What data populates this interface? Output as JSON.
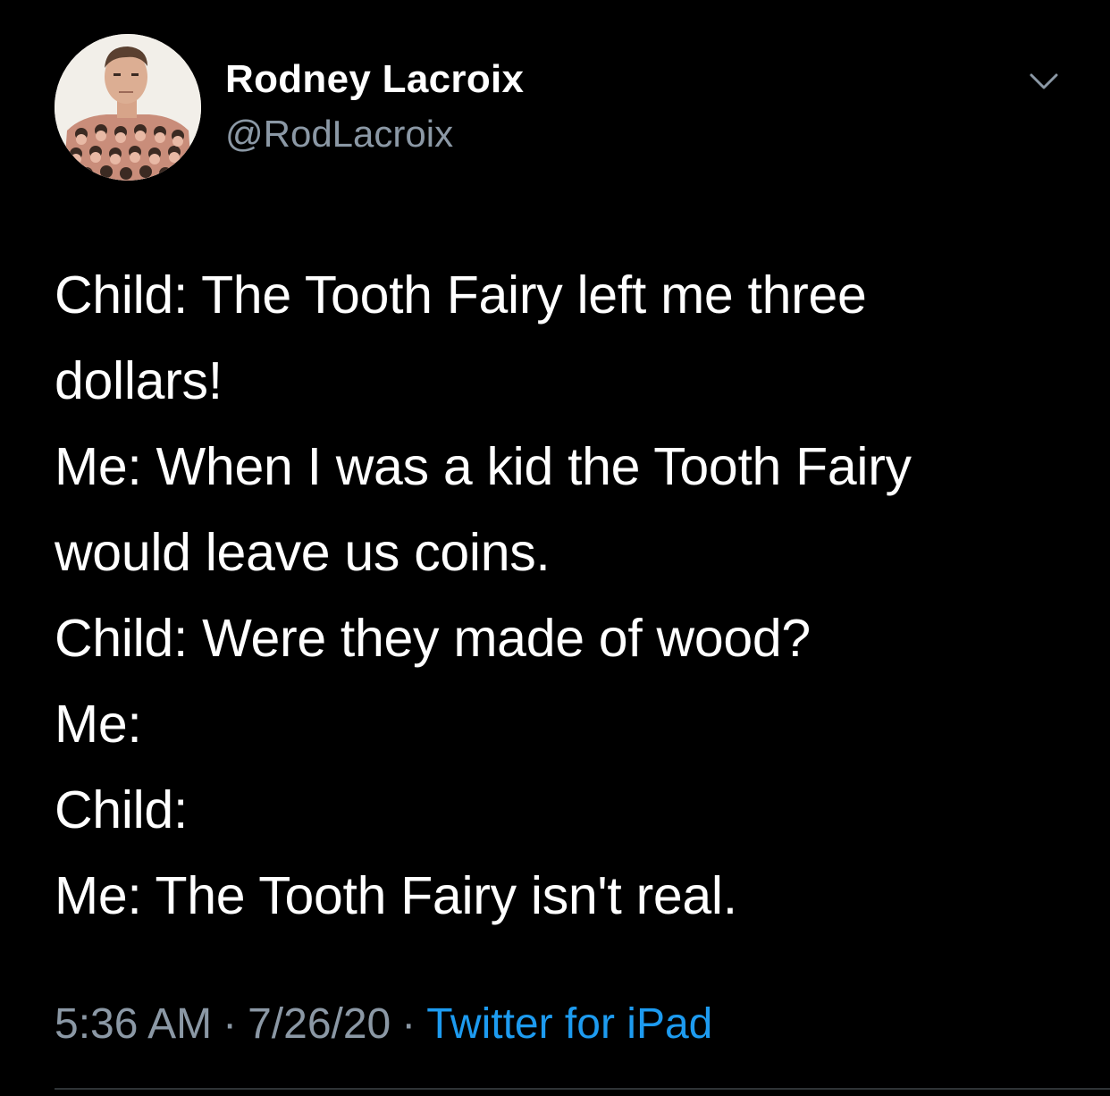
{
  "author": {
    "name": "Rodney Lacroix",
    "handle": "@RodLacroix"
  },
  "tweet": {
    "lines": [
      "Child: The Tooth Fairy left me three",
      "dollars!",
      "Me: When I was a kid the Tooth Fairy",
      "would leave us coins.",
      "Child: Were they made of wood?",
      "Me:",
      "Child:",
      "Me: The Tooth Fairy isn't real."
    ]
  },
  "meta": {
    "time": "5:36 AM",
    "separator": "·",
    "date": "7/26/20",
    "source": "Twitter for iPad"
  },
  "colors": {
    "background": "#000000",
    "text": "#ffffff",
    "secondary": "#8b98a5",
    "link": "#1d9bf0",
    "divider": "#2f3336"
  },
  "icons": {
    "menu": "chevron-down-icon",
    "avatar": "profile-photo"
  }
}
